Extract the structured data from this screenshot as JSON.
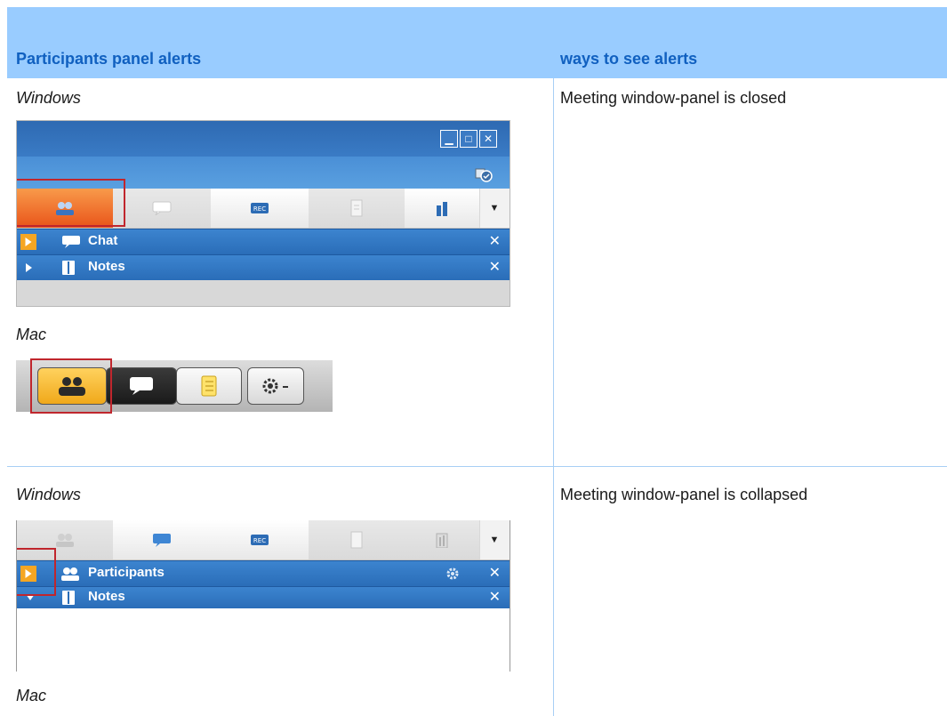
{
  "header": {
    "col1": "Participants panel alerts",
    "col2": "ways to see alerts"
  },
  "row1": {
    "windows_label": "Windows",
    "mac_label": "Mac",
    "description": "Meeting window-panel is closed",
    "panels": [
      {
        "label": "Chat",
        "close": "✕"
      },
      {
        "label": "Notes",
        "close": "✕"
      }
    ]
  },
  "row2": {
    "windows_label": "Windows",
    "mac_label": "Mac",
    "description": "Meeting window-panel is collapsed",
    "panels": [
      {
        "label": "Participants",
        "close": "✕"
      },
      {
        "label": "Notes",
        "close": "✕"
      }
    ]
  },
  "icons": {
    "minimize": "minimize-icon",
    "maximize": "maximize-icon",
    "close": "close-icon",
    "dropdown": "▼",
    "highlight_color": "#c0262d",
    "panel_blue": "#2a6db8",
    "alert_orange": "#f5a623"
  }
}
